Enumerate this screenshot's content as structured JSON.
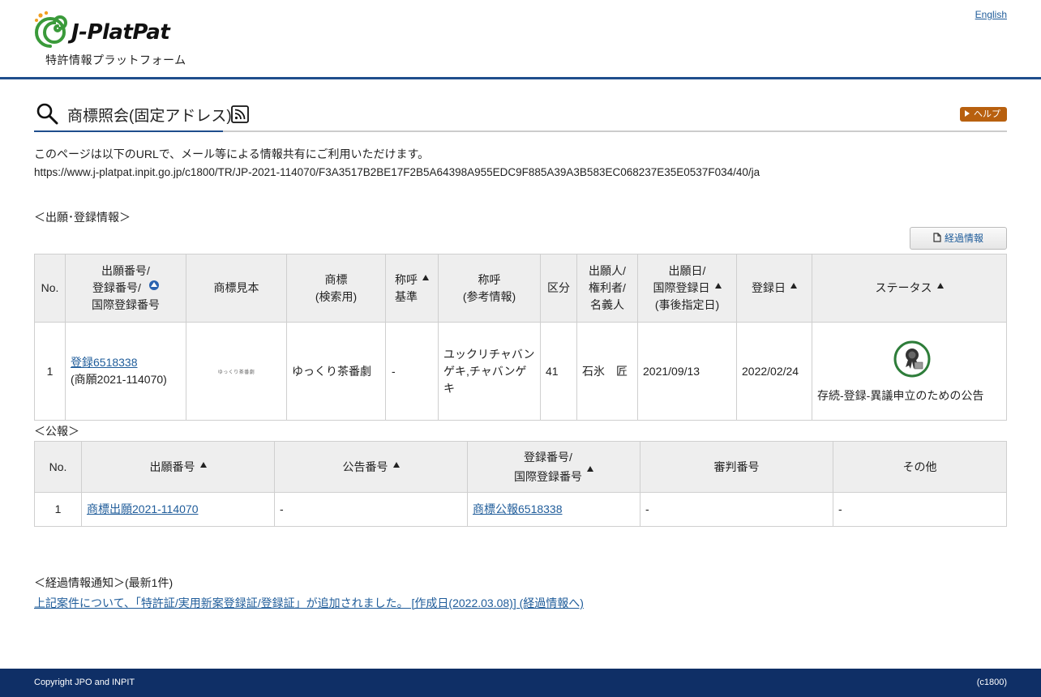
{
  "header": {
    "logo_text": "J-PlatPat",
    "logo_subtitle": "特許情報プラットフォーム",
    "language_link": "English"
  },
  "title_bar": {
    "title": "商標照会(固定アドレス)",
    "help_label": "ヘルプ"
  },
  "info": {
    "description": "このページは以下のURLで、メール等による情報共有にご利用いただけます。",
    "url": "https://www.j-platpat.inpit.go.jp/c1800/TR/JP-2021-114070/F3A3517B2BE17F2B5A64398A955EDC9F885A39A3B583EC068237E35E0537F034/40/ja"
  },
  "application_section": {
    "label": "＜出願･登録情報＞",
    "history_button": "経過情報",
    "headers": {
      "no": "No.",
      "number_l1": "出願番号/",
      "number_l2": "登録番号/",
      "number_l3": "国際登録番号",
      "sample": "商標見本",
      "mark_l1": "商標",
      "mark_l2": "(検索用)",
      "call_l1": "称呼",
      "call_l2": "基準",
      "callref_l1": "称呼",
      "callref_l2": "(参考情報)",
      "class": "区分",
      "applicant_l1": "出願人/",
      "applicant_l2": "権利者/",
      "applicant_l3": "名義人",
      "date_l1": "出願日/",
      "date_l2": "国際登録日",
      "date_l3": "(事後指定日)",
      "regdate": "登録日",
      "status": "ステータス"
    },
    "rows": [
      {
        "no": "1",
        "reg_link": "登録6518338",
        "app_number": "(商願2021-114070)",
        "sample_text": "ゆっくり茶番劇",
        "mark": "ゆっくり茶番劇",
        "call_basis": "-",
        "call_ref": "ユックリチャバンゲキ,チャバンゲキ",
        "class": "41",
        "applicant": "石氷　匠",
        "app_date": "2021/09/13",
        "reg_date": "2022/02/24",
        "status": "存続-登録-異議申立のための公告"
      }
    ]
  },
  "gazette_section": {
    "label": "＜公報＞",
    "headers": {
      "no": "No.",
      "app_number": "出願番号",
      "pub_number": "公告番号",
      "reg_l1": "登録番号/",
      "reg_l2": "国際登録番号",
      "trial": "審判番号",
      "other": "その他"
    },
    "rows": [
      {
        "no": "1",
        "app_link": "商標出願2021-114070",
        "pub_number": "-",
        "reg_link": "商標公報6518338",
        "trial": "-",
        "other": "-"
      }
    ]
  },
  "notice_section": {
    "label": "＜経過情報通知＞(最新1件)",
    "notice_link": "上記案件について、「特許証/実用新案登録証/登録証」が追加されました。 [作成日(2022.03.08)] (経過情報へ)"
  },
  "footer": {
    "copyright": "Copyright JPO and INPIT",
    "code": "(c1800)"
  },
  "colors": {
    "brand_blue": "#1f4e8c",
    "link_blue": "#1f5c9a",
    "help_orange": "#b8600f",
    "footer_navy": "#0f2f66",
    "logo_green": "#3a9a3a",
    "logo_orange": "#f0a020"
  }
}
